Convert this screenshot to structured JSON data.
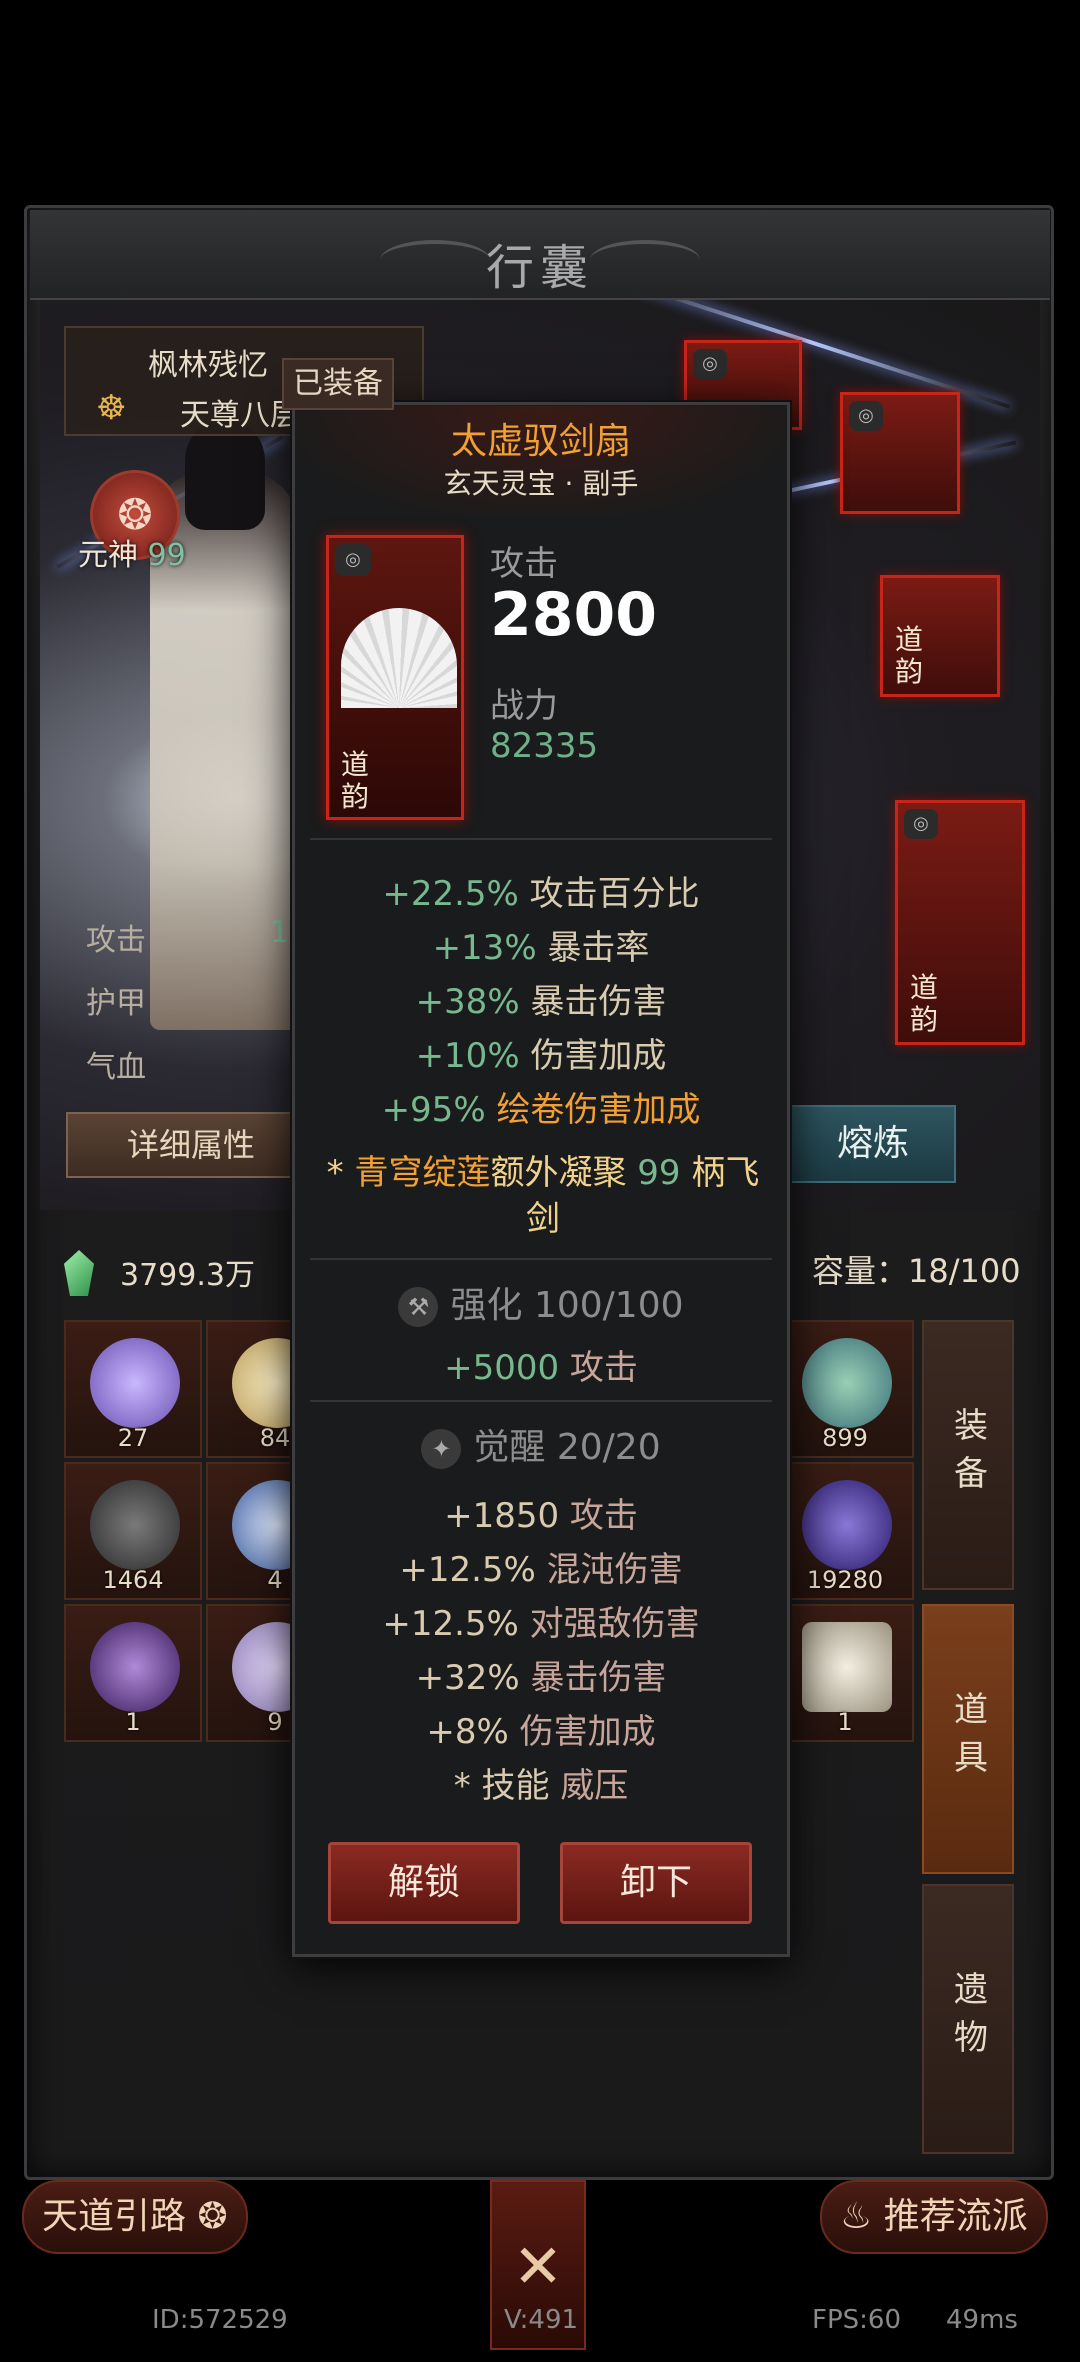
{
  "panel": {
    "title": "行囊"
  },
  "character": {
    "name": "枫林残忆",
    "rank": "天尊八层",
    "soul_label": "元神",
    "soul_value": "99",
    "stats": [
      {
        "label": "攻击",
        "value": "1"
      },
      {
        "label": "护甲",
        "value": ""
      },
      {
        "label": "气血",
        "value": ""
      }
    ],
    "detail_button": "详细属性",
    "smelt_button": "熔炼"
  },
  "equip_slot_text": "道韵",
  "inventory": {
    "currency": "3799.3万",
    "capacity": "容量：18/100",
    "items": [
      {
        "count": "27"
      },
      {
        "count": "84"
      },
      {
        "count": "899"
      },
      {
        "count": "1464"
      },
      {
        "count": "4"
      },
      {
        "count": "19280"
      },
      {
        "count": "1"
      },
      {
        "count": "9"
      },
      {
        "count": "1"
      }
    ],
    "tabs": [
      "装备",
      "道具",
      "遗物"
    ]
  },
  "bottom": {
    "left_button": "天道引路",
    "right_button": "推荐流派",
    "center_icon": "crossed-swords-icon"
  },
  "footer": {
    "id": "ID:572529",
    "version": "V:491",
    "fps": "FPS:60",
    "latency": "49ms"
  },
  "popup": {
    "badge": "已装备",
    "name": "太虚驭剑扇",
    "subtitle": "玄天灵宝 · 副手",
    "icon_text": "道韵",
    "attack_label": "攻击",
    "attack_value": "2800",
    "power_label": "战力",
    "power_value": "82335",
    "base_stats": [
      {
        "value": "+22.5%",
        "name": "攻击百分比"
      },
      {
        "value": "+13%",
        "name": "暴击率"
      },
      {
        "value": "+38%",
        "name": "暴击伤害"
      },
      {
        "value": "+10%",
        "name": "伤害加成"
      },
      {
        "value": "+95%",
        "name": "绘卷伤害加成"
      }
    ],
    "set_effect": {
      "prefix": "* ",
      "skill": "青穹绽莲",
      "mid": "额外凝聚 ",
      "count": "99",
      "suffix": " 柄飞剑"
    },
    "enhance": {
      "label": "强化",
      "value": "100/100",
      "bonus_value": "+5000",
      "bonus_name": "攻击"
    },
    "awaken": {
      "label": "觉醒",
      "value": "20/20",
      "stats": [
        {
          "value": "+1850",
          "name": "攻击"
        },
        {
          "value": "+12.5%",
          "name": "混沌伤害"
        },
        {
          "value": "+12.5%",
          "name": "对强敌伤害"
        },
        {
          "value": "+32%",
          "name": "暴击伤害"
        },
        {
          "value": "+8%",
          "name": "伤害加成"
        }
      ],
      "skill_prefix": "* 技能",
      "skill_name": "威压"
    },
    "unlock_button": "解锁",
    "unequip_button": "卸下"
  },
  "colors": {
    "accent_orange": "#f2a033",
    "stat_green": "#77b88f",
    "button_red": "#8a2a22"
  }
}
